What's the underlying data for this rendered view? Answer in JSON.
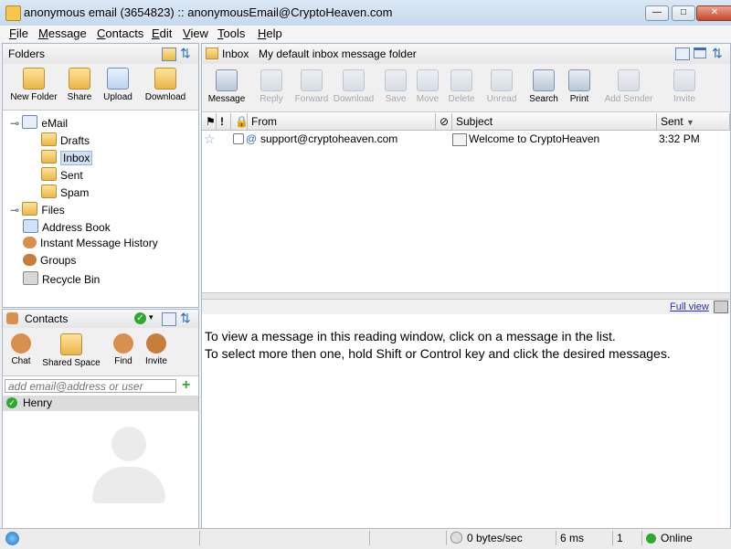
{
  "window": {
    "title": "anonymous email (3654823) :: anonymousEmail@CryptoHeaven.com",
    "min_glyph": "—",
    "max_glyph": "□",
    "close_glyph": "✕"
  },
  "menu": [
    "File",
    "Message",
    "Contacts",
    "Edit",
    "View",
    "Tools",
    "Help"
  ],
  "menu_underline": [
    "F",
    "M",
    "C",
    "E",
    "V",
    "T",
    "H"
  ],
  "folders_panel": {
    "title": "Folders",
    "toolbar": [
      "New Folder",
      "Share",
      "Upload",
      "Download"
    ],
    "tree": [
      {
        "label": "eMail"
      },
      {
        "label": "Drafts"
      },
      {
        "label": "Inbox"
      },
      {
        "label": "Sent"
      },
      {
        "label": "Spam"
      },
      {
        "label": "Files"
      },
      {
        "label": "Address Book"
      },
      {
        "label": "Instant Message History"
      },
      {
        "label": "Groups"
      },
      {
        "label": "Recycle Bin"
      }
    ]
  },
  "contacts_panel": {
    "title": "Contacts",
    "toolbar": [
      "Chat",
      "Shared Space",
      "Find",
      "Invite"
    ],
    "search_placeholder": "add email@address or user",
    "contacts": [
      {
        "name": "Henry",
        "status": "online"
      }
    ]
  },
  "main": {
    "folder_name": "Inbox",
    "folder_desc": "My default inbox message folder",
    "toolbar": [
      {
        "label": "Message",
        "enabled": true
      },
      {
        "label": "Reply",
        "enabled": false
      },
      {
        "label": "Forward",
        "enabled": false
      },
      {
        "label": "Download",
        "enabled": false
      },
      {
        "label": "Save",
        "enabled": false
      },
      {
        "label": "Move",
        "enabled": false
      },
      {
        "label": "Delete",
        "enabled": false
      },
      {
        "label": "Unread",
        "enabled": false
      },
      {
        "label": "Search",
        "enabled": true
      },
      {
        "label": "Print",
        "enabled": true
      },
      {
        "label": "Add Sender",
        "enabled": false
      },
      {
        "label": "Invite",
        "enabled": false
      }
    ],
    "columns": {
      "from": "From",
      "subject": "Subject",
      "sent": "Sent"
    },
    "messages": [
      {
        "from": "support@cryptoheaven.com",
        "subject": "Welcome to CryptoHeaven",
        "sent": "3:32 PM"
      }
    ],
    "reading": {
      "full_view_link": "Full view",
      "line1": "To view a message in this reading window, click on a message in the list.",
      "line2": "To select more then one, hold Shift or Control key and click the desired messages."
    }
  },
  "statusbar": {
    "transfer": "0 bytes/sec",
    "latency": "6 ms",
    "count": "1",
    "status": "Online"
  },
  "colors": {
    "online": "#2ea82e",
    "accent": "#3a6fb5"
  }
}
